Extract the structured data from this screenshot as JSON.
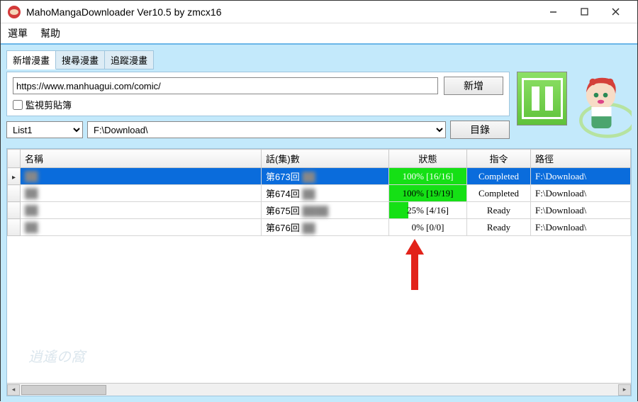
{
  "window": {
    "title": "MahoMangaDownloader Ver10.5 by zmcx16"
  },
  "menu": {
    "file": "選單",
    "help": "幫助"
  },
  "tabs": {
    "add": "新增漫畫",
    "search": "搜尋漫畫",
    "track": "追蹤漫畫"
  },
  "controls": {
    "url_value": "https://www.manhuagui.com/comic/",
    "add_btn": "新增",
    "watch_clip": "監視剪貼簿",
    "list_label": "List1",
    "path_value": "F:\\Download\\",
    "dir_btn": "目錄"
  },
  "grid": {
    "headers": {
      "name": "名稱",
      "chapter": "話(集)數",
      "status": "狀態",
      "command": "指令",
      "path": "路徑"
    },
    "rows": [
      {
        "name": "██",
        "chapter": "第673回 ██",
        "pct": 100,
        "status": "100% [16/16]",
        "command": "Completed",
        "path": "F:\\Download\\",
        "selected": true
      },
      {
        "name": "██",
        "chapter": "第674回 ██",
        "pct": 100,
        "status": "100% [19/19]",
        "command": "Completed",
        "path": "F:\\Download\\",
        "selected": false
      },
      {
        "name": "██",
        "chapter": "第675回 ████",
        "pct": 25,
        "status": "25% [4/16]",
        "command": "Ready",
        "path": "F:\\Download\\",
        "selected": false
      },
      {
        "name": "██",
        "chapter": "第676回 ██",
        "pct": 0,
        "status": "0% [0/0]",
        "command": "Ready",
        "path": "F:\\Download\\",
        "selected": false
      }
    ]
  }
}
